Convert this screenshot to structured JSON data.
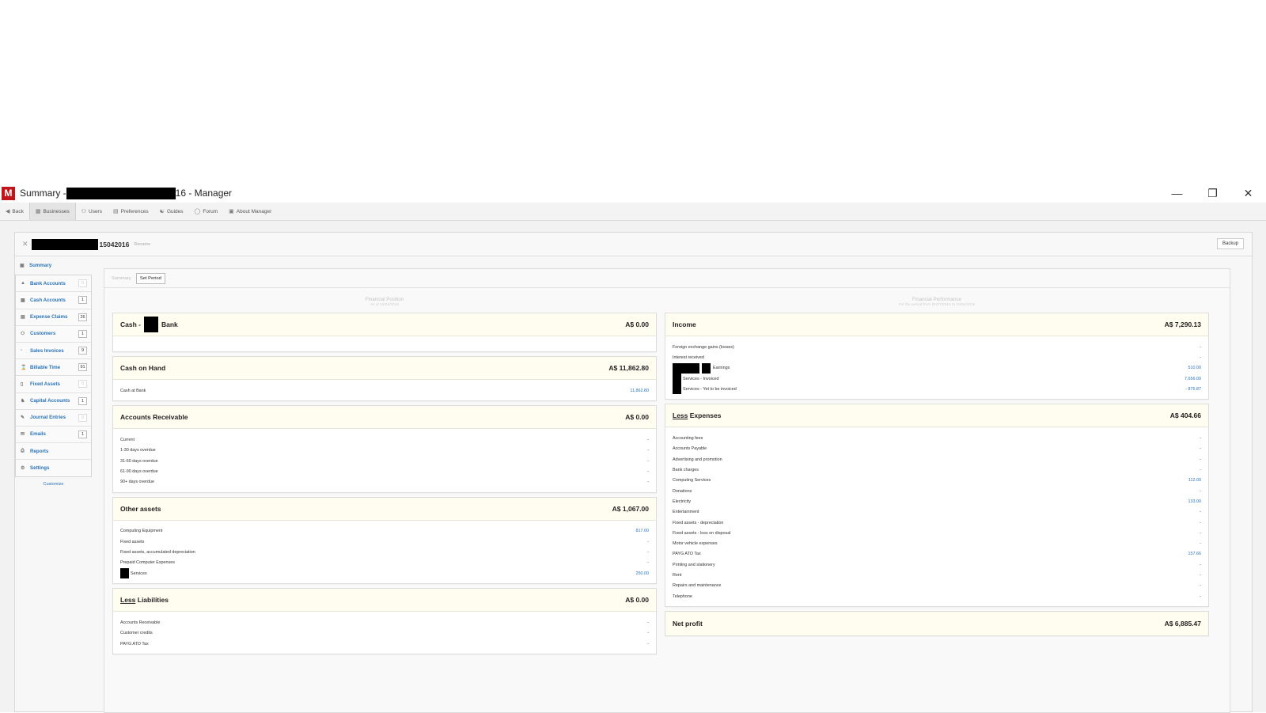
{
  "window": {
    "title_prefix": "Summary - ",
    "title_suffix": "16 - Manager",
    "logo": "M",
    "controls": [
      "minimize-icon",
      "restore-icon",
      "close-icon"
    ]
  },
  "toolbar": {
    "back": "Back",
    "businesses": "Businesses",
    "users": "Users",
    "preferences": "Preferences",
    "guides": "Guides",
    "forum": "Forum",
    "about": "About Manager"
  },
  "business": {
    "name_suffix": "15042016",
    "rename": "Rename",
    "backup": "Backup"
  },
  "sidebar": {
    "summary": "Summary",
    "items": [
      {
        "label": "Bank Accounts",
        "badge": "0",
        "icon": "bank-icon"
      },
      {
        "label": "Cash Accounts",
        "badge": "1",
        "icon": "cash-icon"
      },
      {
        "label": "Expense Claims",
        "badge": "26",
        "icon": "expense-icon"
      },
      {
        "label": "Customers",
        "badge": "1",
        "icon": "customers-icon"
      },
      {
        "label": "Sales Invoices",
        "badge": "9",
        "icon": "invoice-icon"
      },
      {
        "label": "Billable Time",
        "badge": "91",
        "icon": "hourglass-icon"
      },
      {
        "label": "Fixed Assets",
        "badge": "0",
        "icon": "fixed-assets-icon"
      },
      {
        "label": "Capital Accounts",
        "badge": "1",
        "icon": "capital-icon"
      },
      {
        "label": "Journal Entries",
        "badge": "0",
        "icon": "journal-icon"
      },
      {
        "label": "Emails",
        "badge": "1",
        "icon": "email-icon"
      },
      {
        "label": "Reports",
        "badge": "",
        "icon": "reports-icon"
      },
      {
        "label": "Settings",
        "badge": "",
        "icon": "settings-icon"
      }
    ],
    "customize": "Customize"
  },
  "content": {
    "crumb": "Summary",
    "set_period": "Set Period"
  },
  "position": {
    "title": "Financial Position",
    "subtitle": "As at 15/04/2016",
    "cash_bank": {
      "title_a": "Cash -",
      "title_b": "Bank",
      "total": "A$ 0.00"
    },
    "cash_on_hand": {
      "title": "Cash on Hand",
      "total": "A$ 11,862.80",
      "rows": [
        {
          "label": "Cash at Bank",
          "value": "11,862.80"
        }
      ]
    },
    "receivable": {
      "title": "Accounts Receivable",
      "total": "A$ 0.00",
      "rows": [
        {
          "label": "Current",
          "value": "-"
        },
        {
          "label": "1-30 days overdue",
          "value": "-"
        },
        {
          "label": "31-60 days overdue",
          "value": "-"
        },
        {
          "label": "61-90 days overdue",
          "value": "-"
        },
        {
          "label": "90+ days overdue",
          "value": "-"
        }
      ]
    },
    "other_assets": {
      "title": "Other assets",
      "total": "A$ 1,067.00",
      "rows": [
        {
          "label": "Computing Equipment",
          "value": "817.00"
        },
        {
          "label": "Fixed assets",
          "value": "-"
        },
        {
          "label": "Fixed assets, accumulated depreciation",
          "value": "-"
        },
        {
          "label": "Prepaid Computer Expenses",
          "value": "-"
        },
        {
          "label": "Services",
          "value": "250.00"
        }
      ]
    },
    "liabilities": {
      "title_a": "Less",
      "title_b": "Liabilities",
      "total": "A$ 0.00",
      "rows": [
        {
          "label": "Accounts Receivable",
          "value": "-"
        },
        {
          "label": "Customer credits",
          "value": "-"
        },
        {
          "label": "PAYG ATO Tax",
          "value": "-"
        }
      ]
    }
  },
  "performance": {
    "title": "Financial Performance",
    "subtitle": "For the period from 01/07/2015 to 15/04/2016",
    "income": {
      "title": "Income",
      "total": "A$ 7,290.13",
      "rows": [
        {
          "label": "Foreign exchange gains (losses)",
          "value": "-"
        },
        {
          "label": "Interest received",
          "value": "-"
        },
        {
          "label": "Earnings",
          "value": "510.00"
        },
        {
          "label": "Services - Invoiced",
          "value": "7,656.00"
        },
        {
          "label": "Services - Yet to be invoiced",
          "value": "- 875.87"
        }
      ]
    },
    "expenses": {
      "title_a": "Less",
      "title_b": "Expenses",
      "total": "A$ 404.66",
      "rows": [
        {
          "label": "Accounting fees",
          "value": "-"
        },
        {
          "label": "Accounts Payable",
          "value": "-"
        },
        {
          "label": "Advertising and promotion",
          "value": "-"
        },
        {
          "label": "Bank charges",
          "value": "-"
        },
        {
          "label": "Computing Services",
          "value": "112.00"
        },
        {
          "label": "Donations",
          "value": "-"
        },
        {
          "label": "Electricity",
          "value": "133.00"
        },
        {
          "label": "Entertainment",
          "value": "-"
        },
        {
          "label": "Fixed assets - depreciation",
          "value": "-"
        },
        {
          "label": "Fixed assets - loss on disposal",
          "value": "-"
        },
        {
          "label": "Motor vehicle expenses",
          "value": "-"
        },
        {
          "label": "PAYG ATO Tax",
          "value": "157.66"
        },
        {
          "label": "Printing and stationery",
          "value": "-"
        },
        {
          "label": "Rent",
          "value": "-"
        },
        {
          "label": "Repairs and maintenance",
          "value": "-"
        },
        {
          "label": "Telephone",
          "value": "-"
        }
      ]
    },
    "net_profit": {
      "title": "Net profit",
      "total": "A$ 6,885.47"
    }
  }
}
